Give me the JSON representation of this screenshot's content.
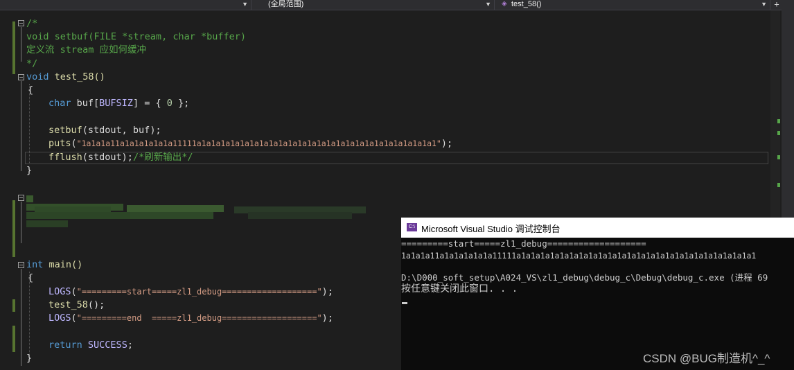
{
  "toolbar": {
    "scope_dropdown": {
      "value": "(全局范围)"
    },
    "function_dropdown": {
      "value": "test_58()"
    },
    "pin_icon": "pin-icon"
  },
  "editor": {
    "code_lines": {
      "l1": "/*",
      "l2": "void setbuf(FILE *stream, char *buffer)",
      "l3": "定义流 stream 应如何缓冲",
      "l4": "*/",
      "l5a": "void",
      "l5b": " test_58()",
      "l6": "{",
      "l7a": "char",
      "l7b": " buf[",
      "l7c": "BUFSIZ",
      "l7d": "] = { ",
      "l7e": "0",
      "l7f": " };",
      "l9a": "setbuf",
      "l9b": "(stdout, buf);",
      "l10a": "puts",
      "l10b": "(",
      "l10c": "\"1a1a1a11a1a1a1a1a1a11111a1a1a1a1a1a1a1a1a1a1a1a1a1a1a1a1a1a1a1a1a1a1a1a1a1\"",
      "l10d": ");",
      "l11a": "fflush",
      "l11b": "(stdout);",
      "l11c": "/*刷新输出*/",
      "l12": "}",
      "m1a": "int",
      "m1b": " main()",
      "m2": "{",
      "m3a": "LOGS",
      "m3b": "(",
      "m3c": "\"=========start=====zl1_debug===================\"",
      "m3d": ");",
      "m4a": "test_58",
      "m4b": "();",
      "m5a": "LOGS",
      "m5b": "(",
      "m5c": "\"=========end  =====zl1_debug===================\"",
      "m5d": ");",
      "m7a": "return",
      "m7b": " ",
      "m7c": "SUCCESS",
      "m7d": ";",
      "m8": "}"
    }
  },
  "console": {
    "title": "Microsoft Visual Studio 调试控制台",
    "icon_label": "C:\\",
    "lines": [
      "=========start=====zl1_debug===================",
      "1a1a1a11a1a1a1a1a1a11111a1a1a1a1a1a1a1a1a1a1a1a1a1a1a1a1a1a1a1a1a1a1a1a1a1",
      "",
      "D:\\D000_soft_setup\\A024_VS\\zl1_debug\\debug_c\\Debug\\debug_c.exe (进程 69",
      "按任意键关闭此窗口. . ."
    ]
  },
  "watermark": "CSDN @BUG制造机^_^",
  "colors": {
    "comment": "#57a64a",
    "keyword": "#569cd6",
    "function": "#dcdcaa",
    "macro": "#beb7ff",
    "string": "#d69d85",
    "number": "#b5cea8",
    "console_bg": "#0c0c0c"
  }
}
